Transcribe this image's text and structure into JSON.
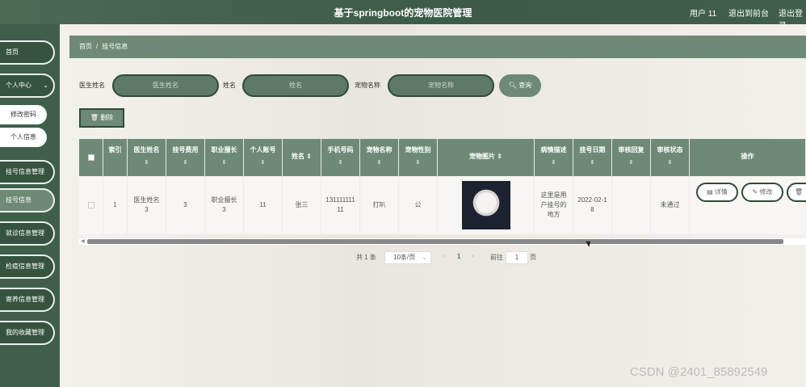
{
  "header": {
    "title": "基于springboot的宠物医院管理",
    "user": "用户 11",
    "front": "退出到前台",
    "logout": "退出登录"
  },
  "sidebar": {
    "items": [
      {
        "label": "首页"
      },
      {
        "label": "个人中心",
        "expanded": true,
        "children": [
          "修改密码",
          "个人信息"
        ]
      },
      {
        "label": "挂号信息管理"
      },
      {
        "label": "挂号信息",
        "active": true
      },
      {
        "label": "就诊信息管理"
      },
      {
        "label": "检疫信息管理"
      },
      {
        "label": "寄养信息管理"
      },
      {
        "label": "我的收藏管理"
      }
    ]
  },
  "breadcrumb": {
    "home": "首页",
    "sep": "/",
    "current": "挂号信息"
  },
  "search": {
    "doctor_label": "医生姓名",
    "doctor_placeholder": "医生姓名",
    "name_label": "姓名",
    "name_placeholder": "姓名",
    "pet_label": "宠物名称",
    "pet_placeholder": "宠物名称",
    "button": "查询"
  },
  "toolbar": {
    "delete": "删除"
  },
  "table": {
    "headers": [
      "索引",
      "医生姓名",
      "挂号费用",
      "职业擅长",
      "个人账号",
      "姓名",
      "手机号码",
      "宠物名称",
      "宠物性别",
      "宠物图片",
      "病情描述",
      "挂号日期",
      "审核回复",
      "审核状态",
      "操作"
    ],
    "rows": [
      {
        "index": "1",
        "doctor": "医生姓名3",
        "fee": "3",
        "specialty": "职业擅长3",
        "account": "11",
        "name": "张三",
        "phone": "13111111111",
        "pet_name": "打叭",
        "pet_gender": "公",
        "pet_image": "white-cat-photo",
        "desc": "这里是用户挂号的地方",
        "date": "2022-02-18",
        "reply": "",
        "status": "未通过",
        "actions": [
          "详情",
          "修改",
          "删除"
        ]
      }
    ]
  },
  "pagination": {
    "total": "共 1 条",
    "page_size": "10条/页",
    "current_page": "1",
    "goto_label": "前往",
    "goto_value": "1",
    "page_unit": "页"
  },
  "watermark": "CSDN @2401_85892549",
  "colors": {
    "primary": "#6e8a77",
    "dark": "#3f5f4b",
    "border": "#2f4a38"
  },
  "icons": {
    "search": "search-icon",
    "delete": "trash-icon",
    "detail": "detail-icon",
    "edit": "edit-icon"
  }
}
